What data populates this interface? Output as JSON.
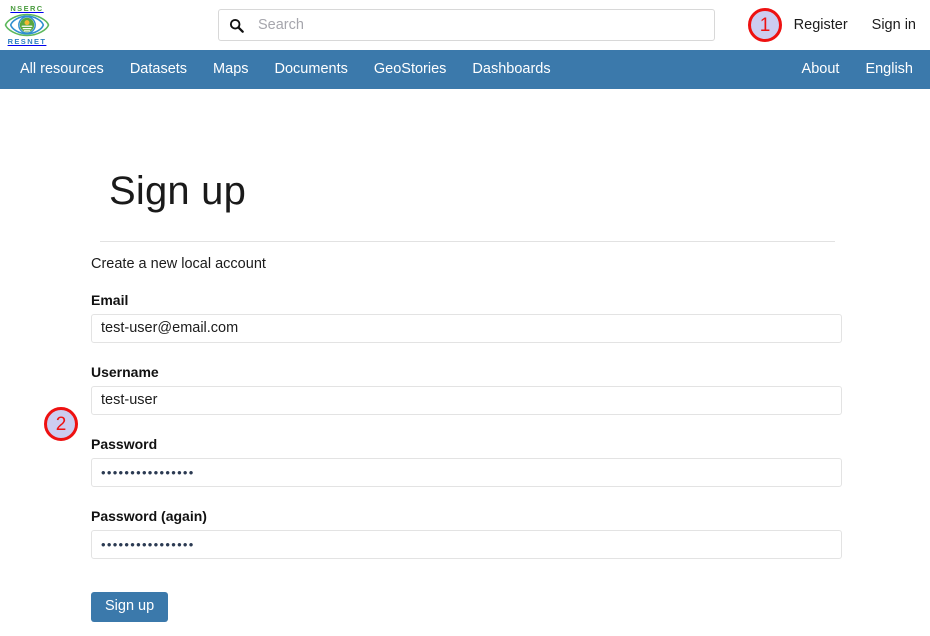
{
  "header": {
    "logo": {
      "top_text": "NSERC",
      "bottom_text": "RESNET",
      "icon": "eye-landscape-logo"
    },
    "search": {
      "placeholder": "Search",
      "value": "",
      "icon": "search-icon"
    },
    "auth": [
      {
        "label": "Register",
        "name": "register-link"
      },
      {
        "label": "Sign in",
        "name": "signin-link"
      }
    ]
  },
  "nav": {
    "left_items": [
      {
        "label": "All resources",
        "name": "nav-all-resources"
      },
      {
        "label": "Datasets",
        "name": "nav-datasets"
      },
      {
        "label": "Maps",
        "name": "nav-maps"
      },
      {
        "label": "Documents",
        "name": "nav-documents"
      },
      {
        "label": "GeoStories",
        "name": "nav-geostories"
      },
      {
        "label": "Dashboards",
        "name": "nav-dashboards"
      }
    ],
    "right_items": [
      {
        "label": "About",
        "name": "nav-about"
      },
      {
        "label": "English",
        "name": "nav-language"
      }
    ],
    "background_color": "#3b79ab"
  },
  "main": {
    "title": "Sign up",
    "subtitle": "Create a new local account",
    "fields": [
      {
        "label": "Email",
        "value": "test-user@email.com",
        "type": "email"
      },
      {
        "label": "Username",
        "value": "test-user",
        "type": "text"
      },
      {
        "label": "Password",
        "value": "••••••••••••••••",
        "type": "password"
      },
      {
        "label": "Password (again)",
        "value": "••••••••••••••••",
        "type": "password"
      }
    ],
    "submit_label": "Sign up",
    "accent_color": "#3b79ab"
  },
  "annotations": [
    {
      "number": "1",
      "target": "register-link"
    },
    {
      "number": "2",
      "target": "email-field"
    }
  ]
}
